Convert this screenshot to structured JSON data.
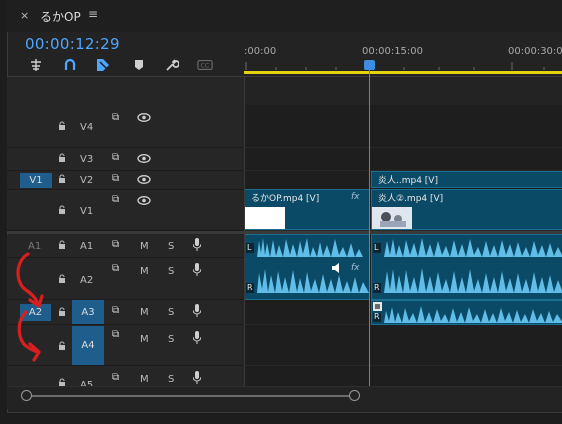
{
  "tab": {
    "close": "×",
    "title": "るかOP",
    "menu": "≡"
  },
  "timecode": "00:00:12:29",
  "ruler": {
    "labels": [
      ":00:00",
      "00:00:15:00",
      "00:00:30:0"
    ]
  },
  "tracks": {
    "v4": "V4",
    "v3": "V3",
    "v2": "V2",
    "v1": "V1",
    "v1_source": "V1",
    "a1": "A1",
    "a1_source": "A1",
    "a2": "A2",
    "a2_source": "A2",
    "a3": "A3",
    "a4": "A4",
    "a5": "A5"
  },
  "buttons": {
    "m": "M",
    "s": "S"
  },
  "clips": {
    "v2_right": "炎人..mp4 [V]",
    "v1_left": "るかOP.mp4 [V]",
    "v1_right": "炎人②.mp4 [V]",
    "fx": "fx",
    "l_marker": "L",
    "r_marker": "R"
  },
  "colors": {
    "accent": "#4ea7ff",
    "clip": "#0b4a66",
    "wave": "#5fbde8",
    "playhead": "#3f8de0",
    "annotation": "#d81f1f"
  }
}
